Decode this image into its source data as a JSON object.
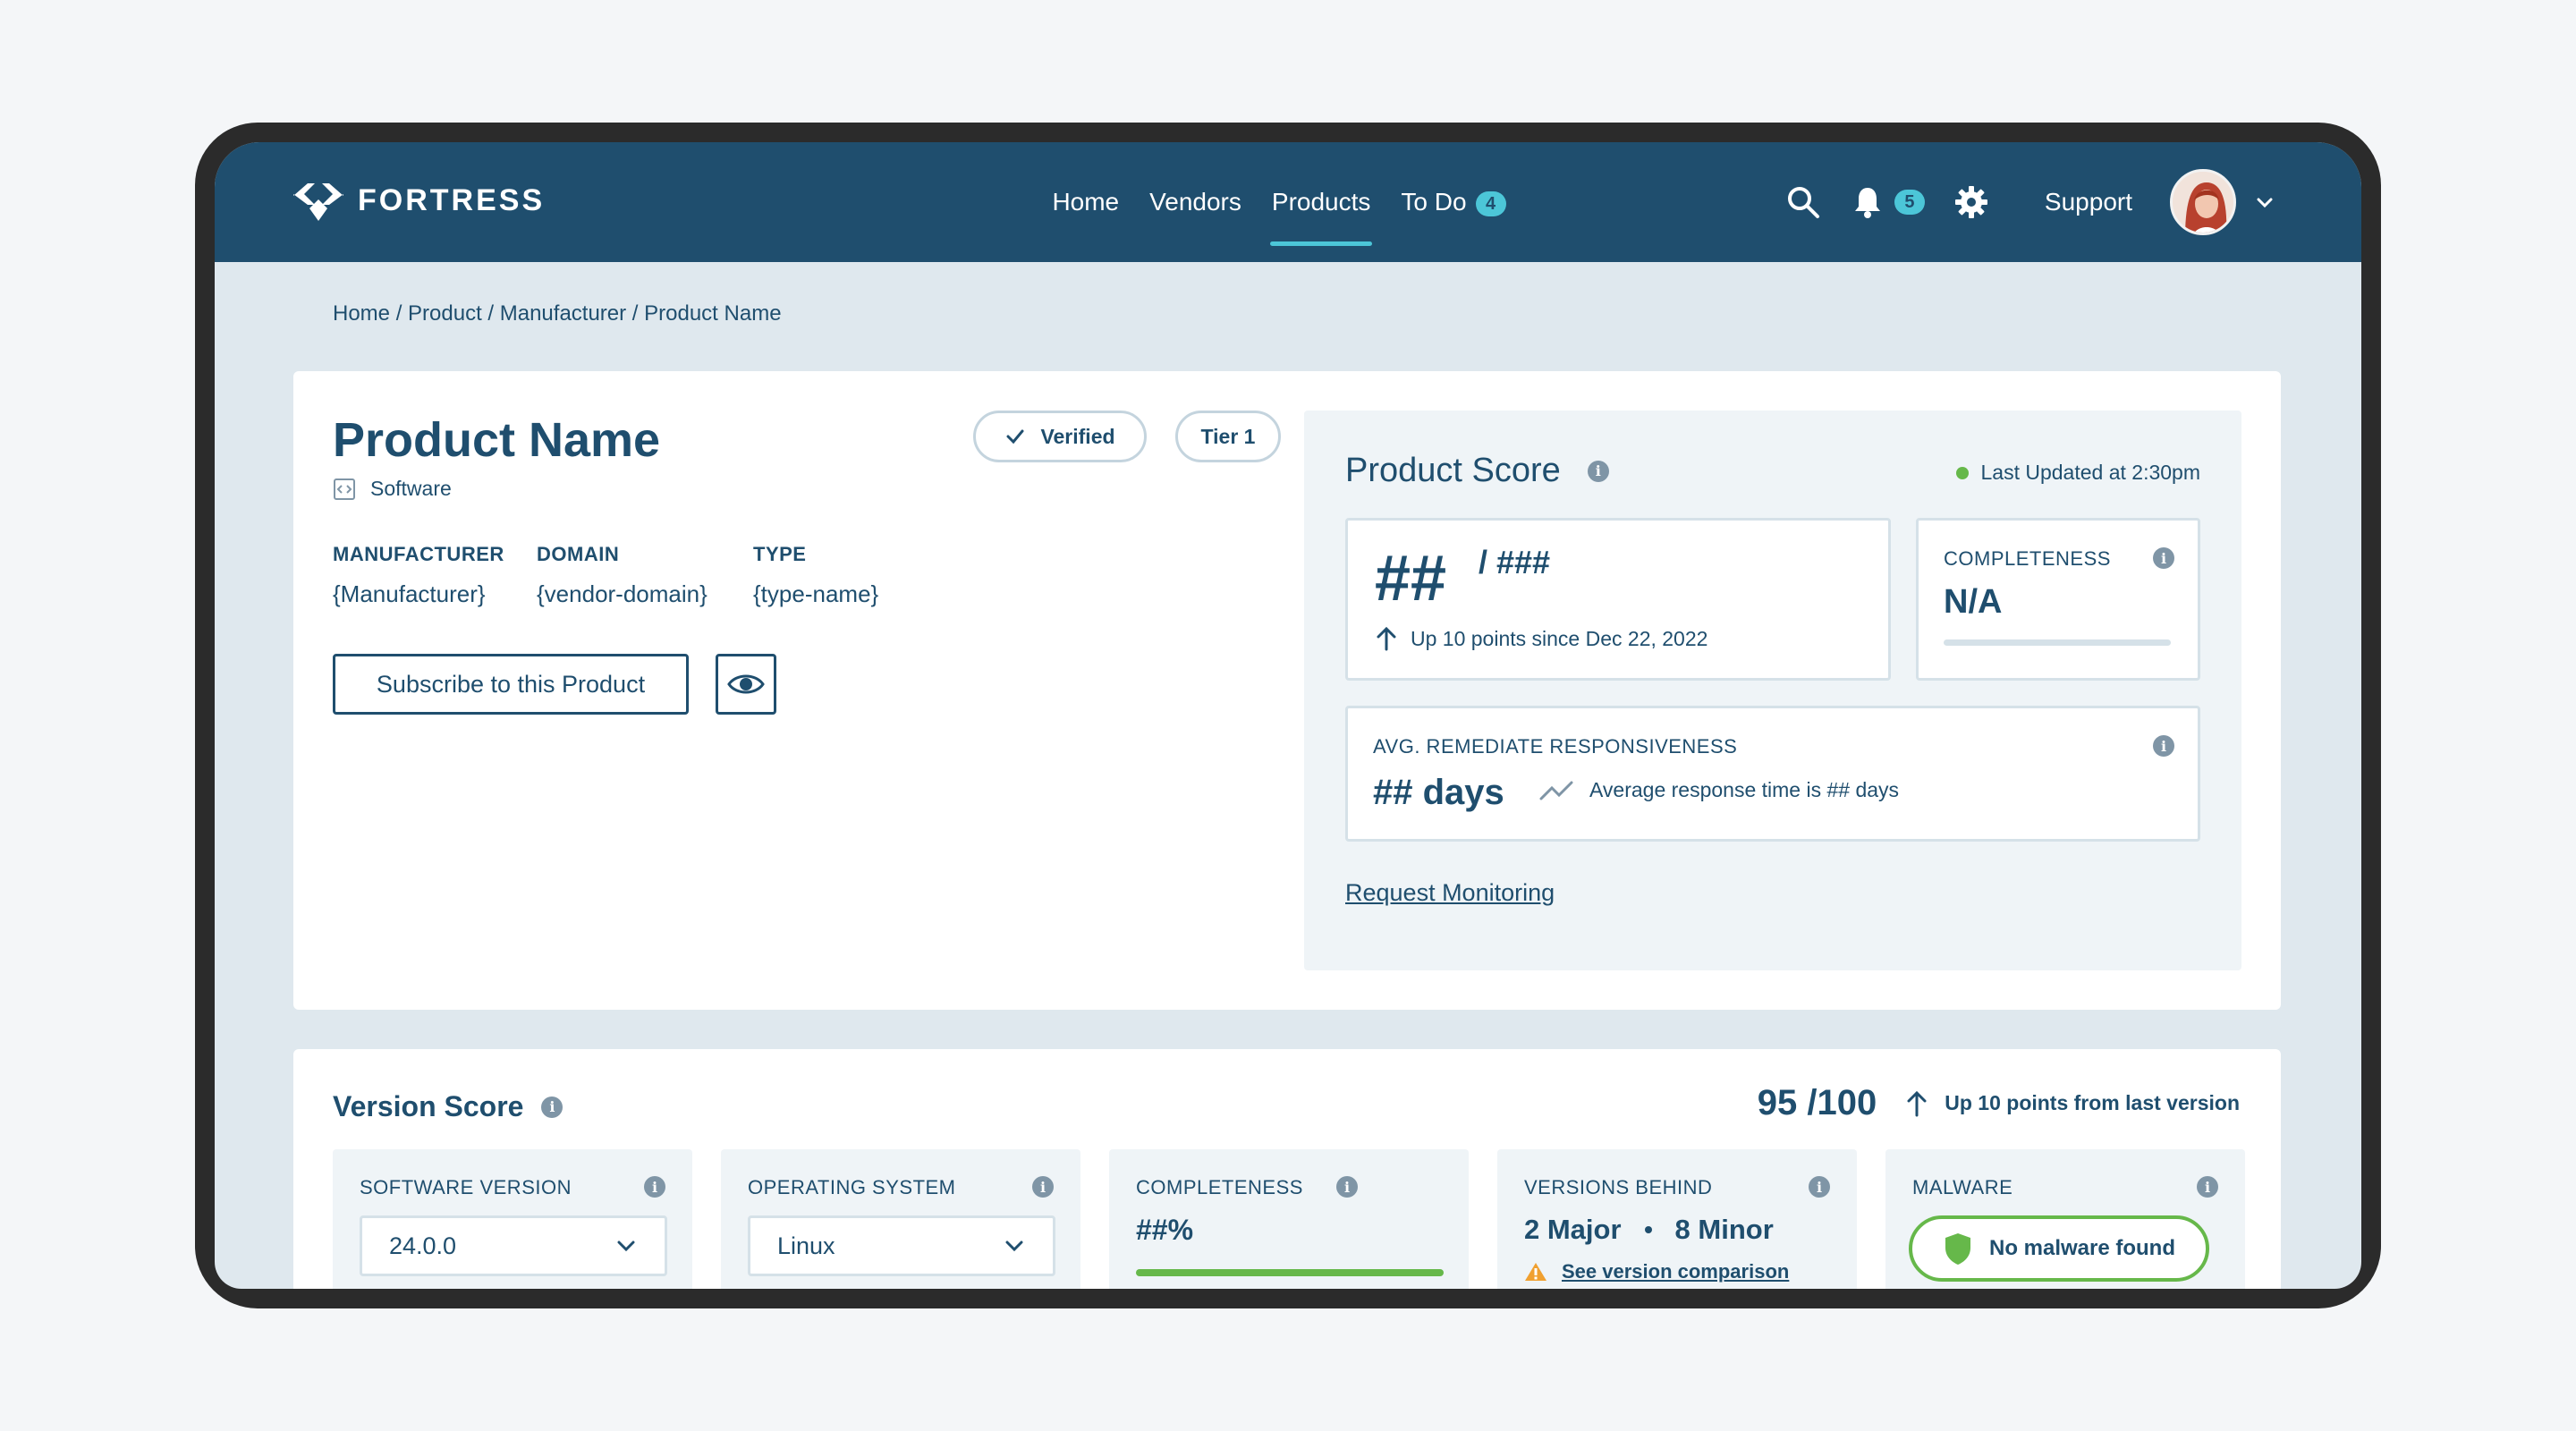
{
  "brand": {
    "name": "FORTRESS"
  },
  "nav": {
    "items": [
      {
        "label": "Home"
      },
      {
        "label": "Vendors"
      },
      {
        "label": "Products",
        "active": true
      },
      {
        "label": "To Do",
        "badge": "4"
      }
    ],
    "notifications_count": "5",
    "support_label": "Support"
  },
  "breadcrumb": "Home / Product / Manufacturer / Product Name",
  "product": {
    "title": "Product Name",
    "type_label": "Software",
    "verified_label": "Verified",
    "tier_label": "Tier 1",
    "meta": [
      {
        "label": "MANUFACTURER",
        "value": "{Manufacturer}"
      },
      {
        "label": "DOMAIN",
        "value": "{vendor-domain}"
      },
      {
        "label": "TYPE",
        "value": "{type-name}"
      }
    ],
    "subscribe_label": "Subscribe to this Product"
  },
  "product_score": {
    "title": "Product Score",
    "last_updated": "Last Updated at 2:30pm",
    "score": "##",
    "max": "/ ###",
    "trend": "Up 10 points since Dec 22, 2022",
    "completeness_label": "COMPLETENESS",
    "completeness_value": "N/A",
    "completeness_fraction": 0,
    "responsiveness_label": "AVG. REMEDIATE RESPONSIVENESS",
    "responsiveness_value": "## days",
    "responsiveness_sub": "Average response time is ## days",
    "request_link": "Request Monitoring"
  },
  "version_score": {
    "title": "Version Score",
    "value": "95 /100",
    "trend": "Up 10 points from last version",
    "cards": {
      "software_version": {
        "label": "SOFTWARE VERSION",
        "value": "24.0.0"
      },
      "operating_system": {
        "label": "OPERATING SYSTEM",
        "value": "Linux"
      },
      "completeness": {
        "label": "COMPLETENESS",
        "value": "##%",
        "fraction": 1
      },
      "versions_behind": {
        "label": "VERSIONS BEHIND",
        "major": "2 Major",
        "minor": "8 Minor",
        "link": "See version comparison"
      },
      "malware": {
        "label": "MALWARE",
        "status": "No malware found"
      }
    }
  },
  "colors": {
    "primary": "#1f4e6e",
    "accent": "#4cc6d8",
    "success": "#66b84a",
    "warning": "#f0a030",
    "background": "#dfe8ee"
  }
}
